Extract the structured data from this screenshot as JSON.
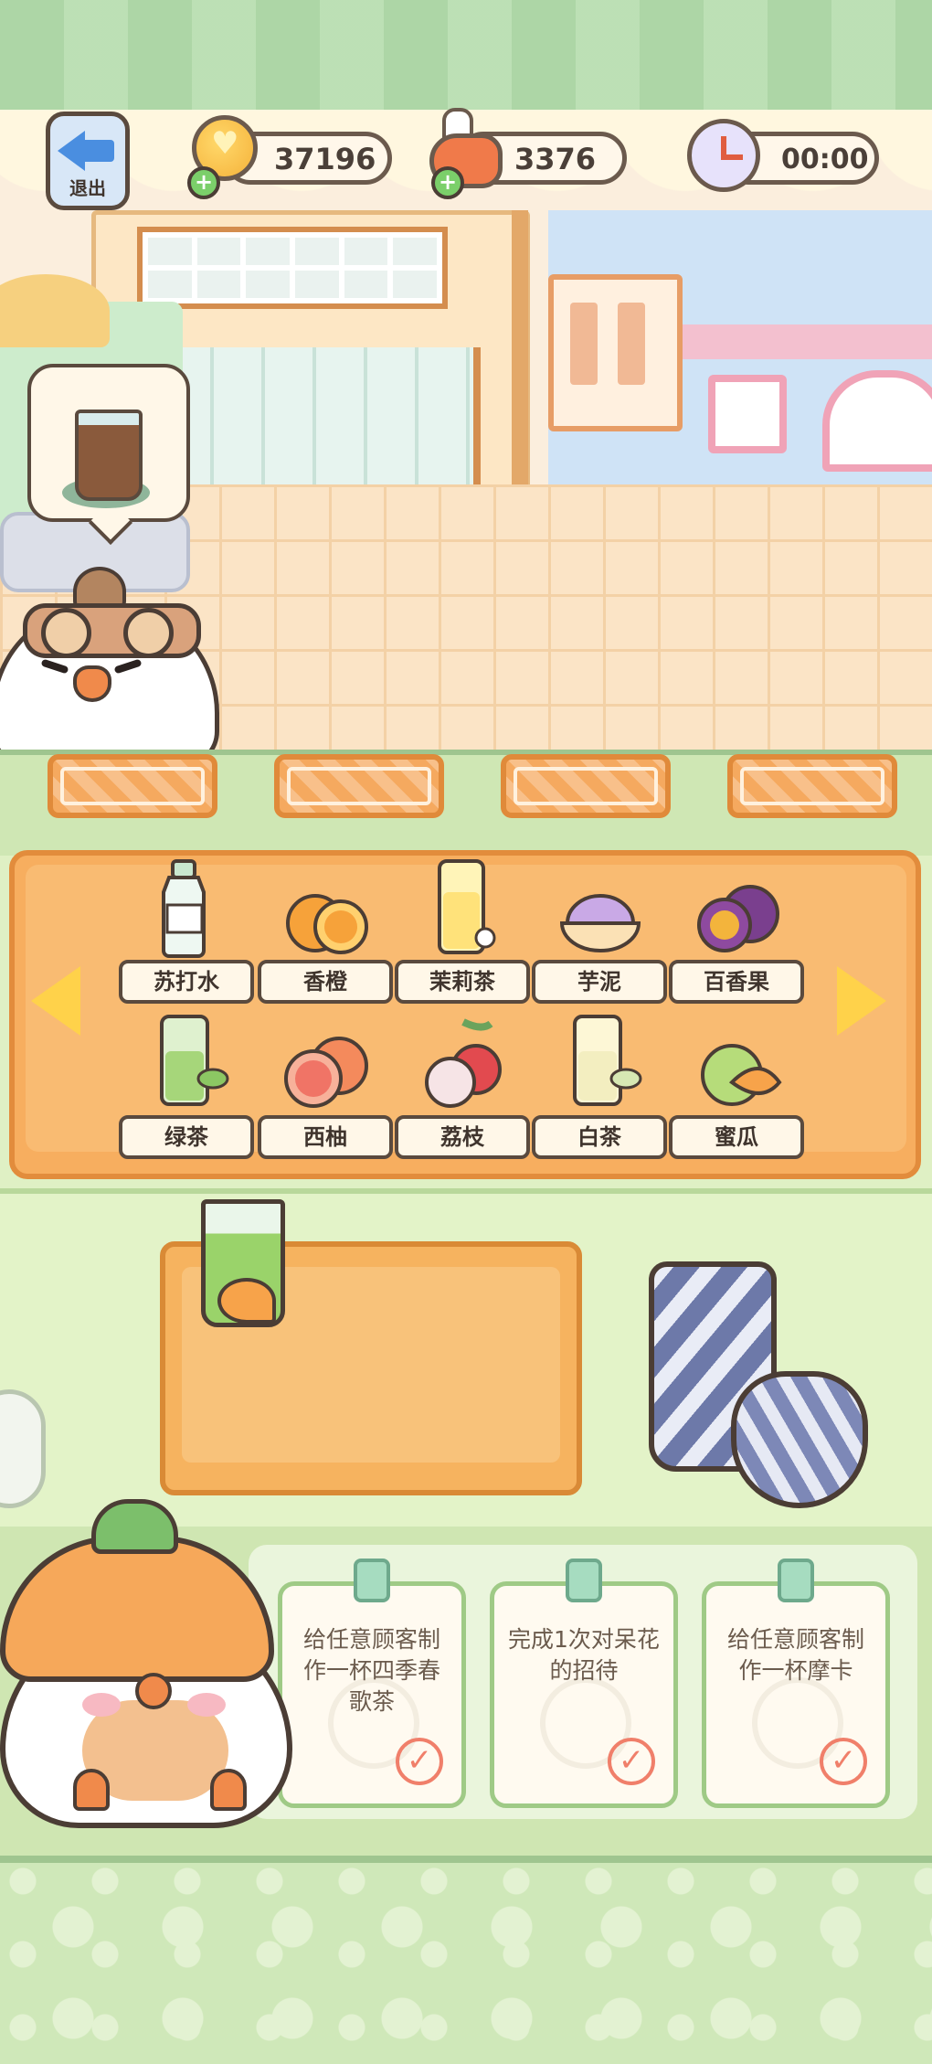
{
  "hud": {
    "exit_label": "退出",
    "coins": "37196",
    "food": "3376",
    "timer": "00:00"
  },
  "order": {
    "drink_icon": "iced-coffee-icon"
  },
  "ingredients": [
    {
      "label": "苏打水",
      "icon": "soda-bottle-icon"
    },
    {
      "label": "香橙",
      "icon": "orange-icon"
    },
    {
      "label": "茉莉茶",
      "icon": "jasmine-tea-icon"
    },
    {
      "label": "芋泥",
      "icon": "taro-paste-icon"
    },
    {
      "label": "百香果",
      "icon": "passion-fruit-icon"
    },
    {
      "label": "绿茶",
      "icon": "green-tea-icon"
    },
    {
      "label": "西柚",
      "icon": "grapefruit-icon"
    },
    {
      "label": "荔枝",
      "icon": "lychee-icon"
    },
    {
      "label": "白茶",
      "icon": "white-tea-icon"
    },
    {
      "label": "蜜瓜",
      "icon": "melon-icon"
    }
  ],
  "tasks": [
    {
      "text": "给任意顾客制作一杯四季春歌茶"
    },
    {
      "text": "完成1次对呆花的招待"
    },
    {
      "text": "给任意顾客制作一杯摩卡"
    }
  ],
  "colors": {
    "panel_orange": "#f7ae5f",
    "accent_yellow": "#ffd24a",
    "outline": "#4b3d35"
  }
}
